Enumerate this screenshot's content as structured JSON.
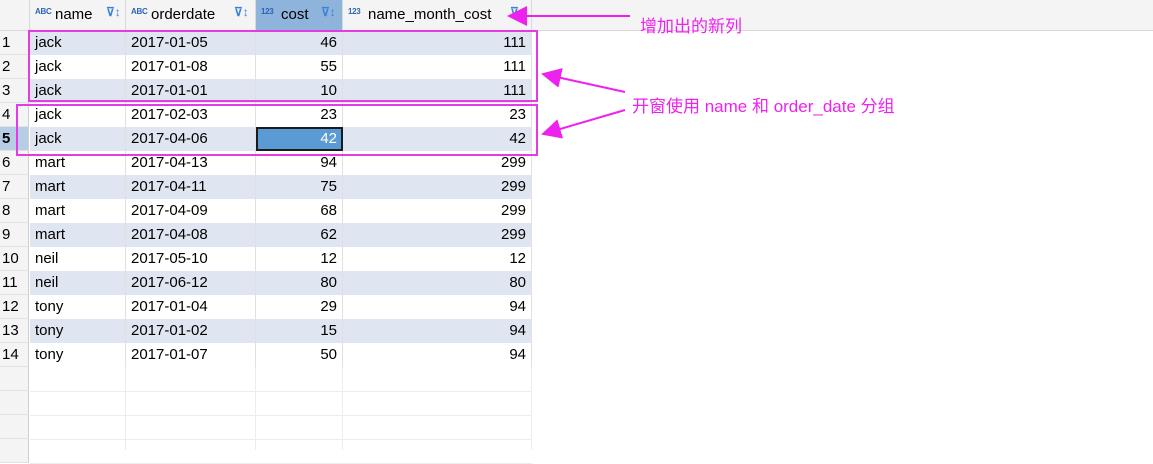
{
  "columns": [
    {
      "type_icon": "ABC",
      "label": "name"
    },
    {
      "type_icon": "ABC",
      "label": "orderdate"
    },
    {
      "type_icon": "123",
      "label": "cost"
    },
    {
      "type_icon": "123",
      "label": "name_month_cost"
    }
  ],
  "rows": [
    {
      "n": "1",
      "name": "jack",
      "orderdate": "2017-01-05",
      "cost": "46",
      "nmc": "111"
    },
    {
      "n": "2",
      "name": "jack",
      "orderdate": "2017-01-08",
      "cost": "55",
      "nmc": "111"
    },
    {
      "n": "3",
      "name": "jack",
      "orderdate": "2017-01-01",
      "cost": "10",
      "nmc": "111"
    },
    {
      "n": "4",
      "name": "jack",
      "orderdate": "2017-02-03",
      "cost": "23",
      "nmc": "23"
    },
    {
      "n": "5",
      "name": "jack",
      "orderdate": "2017-04-06",
      "cost": "42",
      "nmc": "42"
    },
    {
      "n": "6",
      "name": "mart",
      "orderdate": "2017-04-13",
      "cost": "94",
      "nmc": "299"
    },
    {
      "n": "7",
      "name": "mart",
      "orderdate": "2017-04-11",
      "cost": "75",
      "nmc": "299"
    },
    {
      "n": "8",
      "name": "mart",
      "orderdate": "2017-04-09",
      "cost": "68",
      "nmc": "299"
    },
    {
      "n": "9",
      "name": "mart",
      "orderdate": "2017-04-08",
      "cost": "62",
      "nmc": "299"
    },
    {
      "n": "10",
      "name": "neil",
      "orderdate": "2017-05-10",
      "cost": "12",
      "nmc": "12"
    },
    {
      "n": "11",
      "name": "neil",
      "orderdate": "2017-06-12",
      "cost": "80",
      "nmc": "80"
    },
    {
      "n": "12",
      "name": "tony",
      "orderdate": "2017-01-04",
      "cost": "29",
      "nmc": "94"
    },
    {
      "n": "13",
      "name": "tony",
      "orderdate": "2017-01-02",
      "cost": "15",
      "nmc": "94"
    },
    {
      "n": "14",
      "name": "tony",
      "orderdate": "2017-01-07",
      "cost": "50",
      "nmc": "94"
    }
  ],
  "selected_row_number": "5",
  "annotations": {
    "new_column": "增加出的新列",
    "window_partition": "开窗使用 name 和 order_date 分组"
  },
  "colors": {
    "annotation": "#ee22ee",
    "selected_header": "#8fb4dc",
    "alt_row": "#dfe6f1",
    "focus_cell": "#5b9bd5"
  }
}
